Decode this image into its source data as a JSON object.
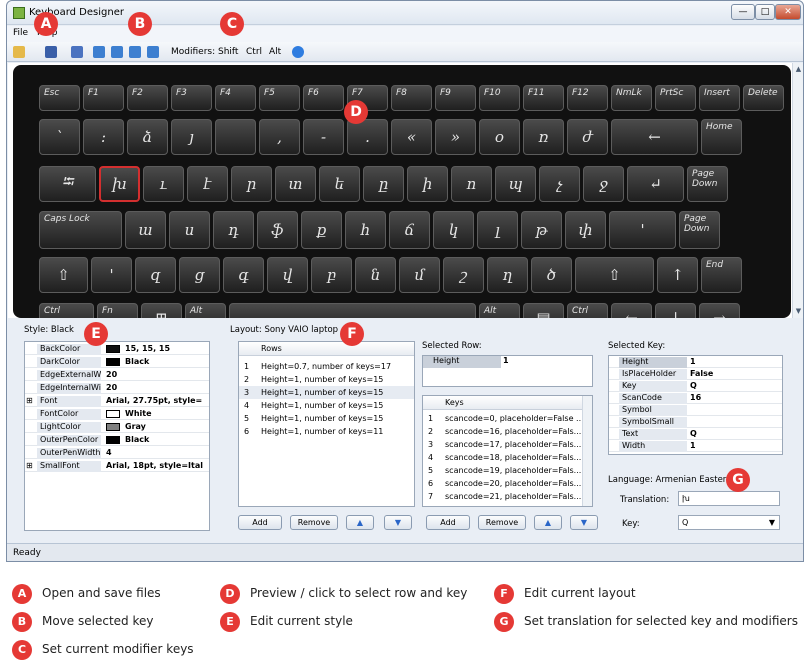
{
  "window": {
    "title": "Keyboard Designer",
    "menu": [
      "File",
      "Help"
    ],
    "minimize": "—",
    "maximize": "□",
    "close": "✕",
    "toolbar_modifiers_label": "Modifiers:",
    "modifiers": [
      "Shift",
      "Ctrl",
      "Alt"
    ]
  },
  "keyboard": {
    "rows": [
      {
        "keys": [
          {
            "fn": "Esc",
            "ch": ""
          },
          {
            "fn": "F1",
            "ch": ""
          },
          {
            "fn": "F2",
            "ch": ""
          },
          {
            "fn": "F3",
            "ch": ""
          },
          {
            "fn": "F4",
            "ch": ""
          },
          {
            "fn": "F5",
            "ch": ""
          },
          {
            "fn": "F6",
            "ch": ""
          },
          {
            "fn": "F7",
            "ch": ""
          },
          {
            "fn": "F8",
            "ch": ""
          },
          {
            "fn": "F9",
            "ch": ""
          },
          {
            "fn": "F10",
            "ch": ""
          },
          {
            "fn": "F11",
            "ch": ""
          },
          {
            "fn": "F12",
            "ch": ""
          },
          {
            "fn": "NmLk",
            "ch": ""
          },
          {
            "fn": "PrtSc",
            "ch": ""
          },
          {
            "fn": "Insert",
            "ch": ""
          },
          {
            "fn": "Delete",
            "ch": ""
          }
        ]
      },
      {
        "keys": [
          {
            "fn": "",
            "ch": "՝"
          },
          {
            "fn": "",
            "ch": ":"
          },
          {
            "fn": "",
            "ch": "ձ"
          },
          {
            "fn": "",
            "ch": "յ"
          },
          {
            "fn": "",
            "ch": ""
          },
          {
            "fn": "",
            "ch": ","
          },
          {
            "fn": "",
            "ch": "-"
          },
          {
            "fn": "",
            "ch": "."
          },
          {
            "fn": "",
            "ch": "«"
          },
          {
            "fn": "",
            "ch": "»"
          },
          {
            "fn": "",
            "ch": "օ"
          },
          {
            "fn": "",
            "ch": "ռ"
          },
          {
            "fn": "",
            "ch": "ժ"
          },
          {
            "fn": "",
            "ch": "←"
          },
          {
            "fn": "Home",
            "ch": ""
          }
        ]
      },
      {
        "keys": [
          {
            "fn": "",
            "ch": "⭾"
          },
          {
            "fn": "",
            "ch": "խ"
          },
          {
            "fn": "",
            "ch": "ւ"
          },
          {
            "fn": "",
            "ch": "է"
          },
          {
            "fn": "",
            "ch": "ր"
          },
          {
            "fn": "",
            "ch": "տ"
          },
          {
            "fn": "",
            "ch": "ե"
          },
          {
            "fn": "",
            "ch": "ը"
          },
          {
            "fn": "",
            "ch": "ի"
          },
          {
            "fn": "",
            "ch": "ո"
          },
          {
            "fn": "",
            "ch": "պ"
          },
          {
            "fn": "",
            "ch": "չ"
          },
          {
            "fn": "",
            "ch": "ջ"
          },
          {
            "fn": "",
            "ch": "↵"
          },
          {
            "fn": "Page Down",
            "ch": ""
          }
        ]
      },
      {
        "keys": [
          {
            "fn": "Caps Lock",
            "ch": ""
          },
          {
            "fn": "",
            "ch": "ա"
          },
          {
            "fn": "",
            "ch": "ս"
          },
          {
            "fn": "",
            "ch": "դ"
          },
          {
            "fn": "",
            "ch": "ֆ"
          },
          {
            "fn": "",
            "ch": "ք"
          },
          {
            "fn": "",
            "ch": "հ"
          },
          {
            "fn": "",
            "ch": "ճ"
          },
          {
            "fn": "",
            "ch": "կ"
          },
          {
            "fn": "",
            "ch": "լ"
          },
          {
            "fn": "",
            "ch": "թ"
          },
          {
            "fn": "",
            "ch": "փ"
          },
          {
            "fn": "",
            "ch": "'"
          },
          {
            "fn": "Page Down",
            "ch": ""
          }
        ]
      },
      {
        "keys": [
          {
            "fn": "",
            "ch": "⇧"
          },
          {
            "fn": "",
            "ch": "'"
          },
          {
            "fn": "",
            "ch": "զ"
          },
          {
            "fn": "",
            "ch": "ց"
          },
          {
            "fn": "",
            "ch": "գ"
          },
          {
            "fn": "",
            "ch": "վ"
          },
          {
            "fn": "",
            "ch": "բ"
          },
          {
            "fn": "",
            "ch": "ն"
          },
          {
            "fn": "",
            "ch": "մ"
          },
          {
            "fn": "",
            "ch": "շ"
          },
          {
            "fn": "",
            "ch": "ղ"
          },
          {
            "fn": "",
            "ch": "ծ"
          },
          {
            "fn": "",
            "ch": "⇧"
          },
          {
            "fn": "",
            "ch": "↑"
          },
          {
            "fn": "End",
            "ch": ""
          }
        ]
      },
      {
        "keys": [
          {
            "fn": "Ctrl",
            "ch": ""
          },
          {
            "fn": "Fn",
            "ch": ""
          },
          {
            "fn": "",
            "ch": "⊞"
          },
          {
            "fn": "Alt",
            "ch": ""
          },
          {
            "fn": "",
            "ch": ""
          },
          {
            "fn": "Alt",
            "ch": ""
          },
          {
            "fn": "",
            "ch": "▤"
          },
          {
            "fn": "Ctrl",
            "ch": ""
          },
          {
            "fn": "",
            "ch": "←"
          },
          {
            "fn": "",
            "ch": "↓"
          },
          {
            "fn": "",
            "ch": "→"
          }
        ]
      }
    ]
  },
  "style_panel": {
    "title": "Style: Black",
    "properties": [
      {
        "name": "BackColor",
        "value": "15, 15, 15",
        "swatch": "#0f0f0f",
        "expand": ""
      },
      {
        "name": "DarkColor",
        "value": "Black",
        "swatch": "#000000",
        "expand": ""
      },
      {
        "name": "EdgeExternalWidth",
        "value": "20",
        "swatch": "",
        "expand": ""
      },
      {
        "name": "EdgeInternalWidth",
        "value": "20",
        "swatch": "",
        "expand": ""
      },
      {
        "name": "Font",
        "value": "Arial, 27.75pt, style=",
        "swatch": "",
        "expand": "⊞"
      },
      {
        "name": "FontColor",
        "value": "White",
        "swatch": "#ffffff",
        "expand": ""
      },
      {
        "name": "LightColor",
        "value": "Gray",
        "swatch": "#808080",
        "expand": ""
      },
      {
        "name": "OuterPenColor",
        "value": "Black",
        "swatch": "#000000",
        "expand": ""
      },
      {
        "name": "OuterPenWidth",
        "value": "4",
        "swatch": "",
        "expand": ""
      },
      {
        "name": "SmallFont",
        "value": "Arial, 18pt, style=Ital",
        "swatch": "",
        "expand": "⊞"
      }
    ]
  },
  "layout_panel": {
    "title": "Layout: Sony VAIO laptop",
    "header": "Rows",
    "rows": [
      {
        "num": "1",
        "text": "Height=0.7, number of keys=17"
      },
      {
        "num": "2",
        "text": "Height=1, number of keys=15"
      },
      {
        "num": "3",
        "text": "Height=1, number of keys=15"
      },
      {
        "num": "4",
        "text": "Height=1, number of keys=15"
      },
      {
        "num": "5",
        "text": "Height=1, number of keys=15"
      },
      {
        "num": "6",
        "text": "Height=1, number of keys=11"
      }
    ],
    "add": "Add",
    "remove": "Remove"
  },
  "selected_row": {
    "title": "Selected Row:",
    "height_label": "Height",
    "height_value": "1",
    "keys_header": "Keys",
    "keys": [
      {
        "num": "1",
        "text": "scancode=0, placeholder=False ..."
      },
      {
        "num": "2",
        "text": "scancode=16, placeholder=Fals..."
      },
      {
        "num": "3",
        "text": "scancode=17, placeholder=Fals..."
      },
      {
        "num": "4",
        "text": "scancode=18, placeholder=Fals..."
      },
      {
        "num": "5",
        "text": "scancode=19, placeholder=Fals..."
      },
      {
        "num": "6",
        "text": "scancode=20, placeholder=Fals..."
      },
      {
        "num": "7",
        "text": "scancode=21, placeholder=Fals..."
      }
    ],
    "add": "Add",
    "remove": "Remove"
  },
  "selected_key": {
    "title": "Selected Key:",
    "properties": [
      {
        "name": "Height",
        "value": "1"
      },
      {
        "name": "IsPlaceHolder",
        "value": "False"
      },
      {
        "name": "Key",
        "value": "Q"
      },
      {
        "name": "ScanCode",
        "value": "16"
      },
      {
        "name": "Symbol",
        "value": ""
      },
      {
        "name": "SymbolSmall",
        "value": ""
      },
      {
        "name": "Text",
        "value": "Q"
      },
      {
        "name": "Width",
        "value": "1"
      }
    ],
    "language_label": "Language: Armenian Eastern",
    "translation_label": "Translation:",
    "translation_value": "խ",
    "key_label": "Key:",
    "key_value": "Q"
  },
  "status": {
    "text": "Ready"
  },
  "legend": [
    {
      "letter": "A",
      "text": "Open and save files"
    },
    {
      "letter": "B",
      "text": "Move  selected key"
    },
    {
      "letter": "C",
      "text": "Set current modifier keys"
    },
    {
      "letter": "D",
      "text": "Preview / click to select row and key"
    },
    {
      "letter": "E",
      "text": "Edit current style"
    },
    {
      "letter": "F",
      "text": "Edit current layout"
    },
    {
      "letter": "G",
      "text": "Set  translation for selected key and modifiers"
    }
  ],
  "callouts": [
    "A",
    "B",
    "C",
    "D",
    "E",
    "F",
    "G"
  ]
}
